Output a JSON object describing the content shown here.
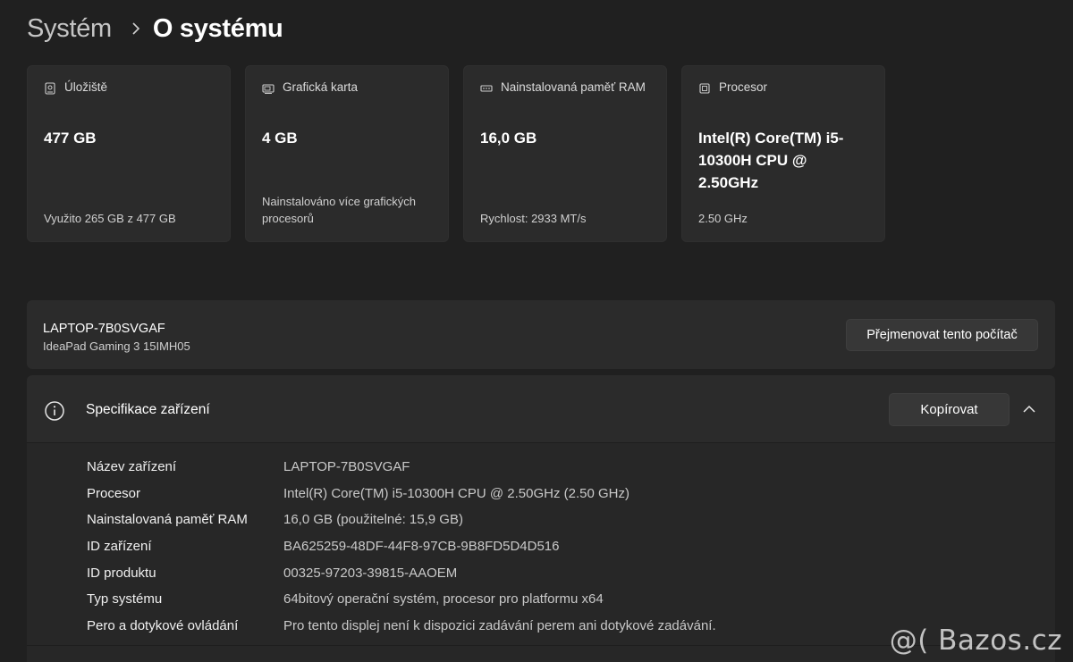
{
  "breadcrumb": {
    "parent": "Systém",
    "current": "O systému",
    "separator_icon": "chevron-right-icon"
  },
  "cards": [
    {
      "icon": "storage-icon",
      "title": "Úložiště",
      "value": "477 GB",
      "sub": "Využito 265 GB z 477 GB"
    },
    {
      "icon": "graphics-card-icon",
      "title": "Grafická karta",
      "value": "4 GB",
      "sub": "Nainstalováno více grafických procesorů"
    },
    {
      "icon": "memory-icon",
      "title": "Nainstalovaná paměť RAM",
      "value": "16,0 GB",
      "sub": "Rychlost: 2933 MT/s"
    },
    {
      "icon": "processor-icon",
      "title": "Procesor",
      "value": "Intel(R) Core(TM) i5-10300H CPU @ 2.50GHz",
      "sub": "2.50 GHz"
    }
  ],
  "device": {
    "name": "LAPTOP-7B0SVGAF",
    "model": "IdeaPad Gaming 3 15IMH05",
    "rename_button": "Přejmenovat tento počítač"
  },
  "specs": {
    "title": "Specifikace zařízení",
    "copy_button": "Kopírovat",
    "rows": [
      {
        "label": "Název zařízení",
        "value": "LAPTOP-7B0SVGAF"
      },
      {
        "label": "Procesor",
        "value": "Intel(R) Core(TM) i5-10300H CPU @ 2.50GHz (2.50 GHz)"
      },
      {
        "label": "Nainstalovaná paměť RAM",
        "value": "16,0 GB (použitelné: 15,9 GB)"
      },
      {
        "label": "ID zařízení",
        "value": "BA625259-48DF-44F8-97CB-9B8FD5D4D516"
      },
      {
        "label": "ID produktu",
        "value": "00325-97203-39815-AAOEM"
      },
      {
        "label": "Typ systému",
        "value": "64bitový operační systém, procesor pro platformu x64"
      },
      {
        "label": "Pero a dotykové ovládání",
        "value": "Pro tento displej není k dispozici zadávání perem ani dotykové zadávání."
      }
    ]
  },
  "watermark": "@( Bazos.cz",
  "colors": {
    "background": "#202020",
    "card": "#2b2b2b",
    "button": "#373737",
    "text": "#ffffff",
    "text_secondary": "#c9c9c9"
  }
}
